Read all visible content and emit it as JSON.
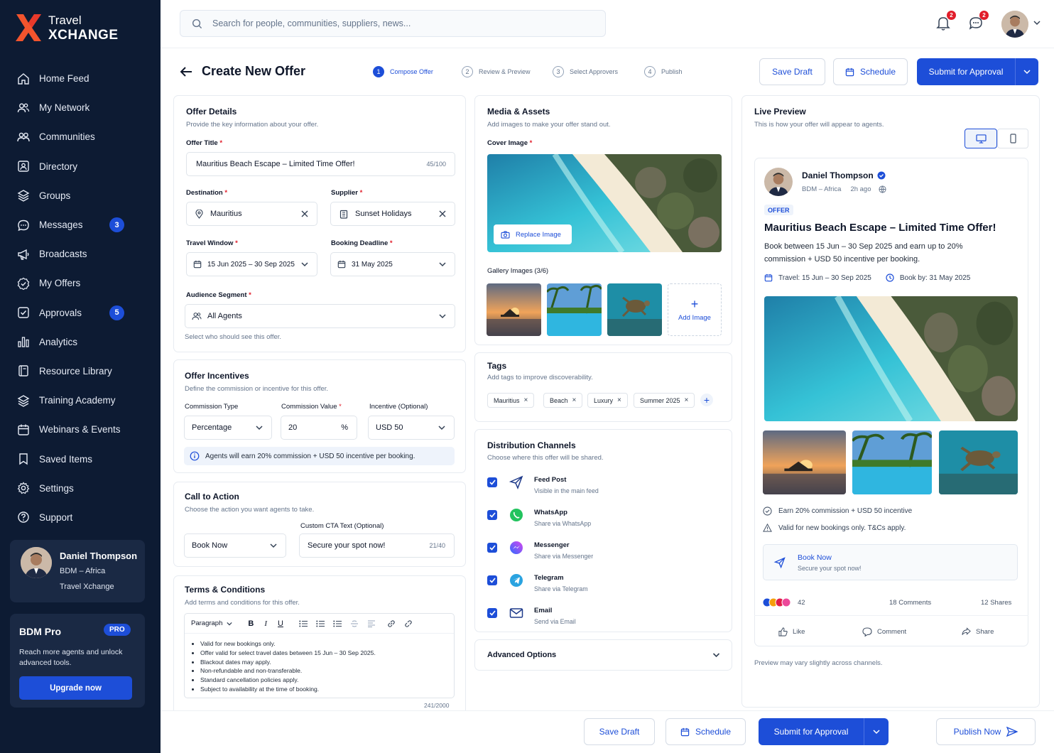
{
  "app": {
    "logo_line1": "Travel",
    "logo_line2": "XCHANGE"
  },
  "sidebar": {
    "items": [
      {
        "label": "Home Feed",
        "icon": "home-icon"
      },
      {
        "label": "My Network",
        "icon": "users-icon"
      },
      {
        "label": "Communities",
        "icon": "communities-icon"
      },
      {
        "label": "Directory",
        "icon": "directory-icon"
      },
      {
        "label": "Groups",
        "icon": "layers-icon"
      },
      {
        "label": "Messages",
        "icon": "chat-icon",
        "badge": "3"
      },
      {
        "label": "Broadcasts",
        "icon": "megaphone-icon"
      },
      {
        "label": "My Offers",
        "icon": "badge-check-icon"
      },
      {
        "label": "Approvals",
        "icon": "checkbox-icon",
        "badge": "5"
      },
      {
        "label": "Analytics",
        "icon": "bar-chart-icon"
      },
      {
        "label": "Resource Library",
        "icon": "book-icon"
      },
      {
        "label": "Training Academy",
        "icon": "layers-icon"
      },
      {
        "label": "Webinars & Events",
        "icon": "calendar-icon"
      },
      {
        "label": "Saved Items",
        "icon": "bookmark-icon"
      },
      {
        "label": "Settings",
        "icon": "gear-icon"
      },
      {
        "label": "Support",
        "icon": "help-icon"
      }
    ],
    "profile": {
      "name": "Daniel Thompson",
      "role": "BDM – Africa",
      "company": "Travel Xchange"
    },
    "pro": {
      "title": "BDM Pro",
      "badge": "PRO",
      "desc": "Reach more agents and unlock advanced tools.",
      "cta": "Upgrade now"
    }
  },
  "topbar": {
    "search_placeholder": "Search for people, communities, suppliers, news...",
    "notif_count": "2",
    "msg_count": "2"
  },
  "header": {
    "title": "Create New Offer",
    "steps": [
      {
        "n": "1",
        "label": "Compose Offer",
        "active": true
      },
      {
        "n": "2",
        "label": "Review & Preview"
      },
      {
        "n": "3",
        "label": "Select Approvers"
      },
      {
        "n": "4",
        "label": "Publish"
      }
    ],
    "save_draft": "Save Draft",
    "schedule": "Schedule",
    "submit": "Submit for Approval"
  },
  "offer_details": {
    "title": "Offer Details",
    "subtitle": "Provide the key information about your offer.",
    "offer_title_label": "Offer Title",
    "offer_title_value": "Mauritius Beach Escape – Limited Time Offer!",
    "offer_title_count": "45/100",
    "destination_label": "Destination",
    "destination_value": "Mauritius",
    "supplier_label": "Supplier",
    "supplier_value": "Sunset Holidays",
    "travel_window_label": "Travel Window",
    "travel_window_value": "15 Jun 2025 – 30 Sep 2025",
    "booking_deadline_label": "Booking Deadline",
    "booking_deadline_value": "31 May 2025",
    "audience_label": "Audience Segment",
    "audience_value": "All Agents",
    "audience_help": "Select who should see this offer."
  },
  "incentives": {
    "title": "Offer Incentives",
    "subtitle": "Define the commission or incentive for this offer.",
    "type_label": "Commission Type",
    "type_value": "Percentage",
    "value_label": "Commission Value",
    "value_value": "20",
    "value_unit": "%",
    "incentive_label": "Incentive (Optional)",
    "incentive_value": "USD 50",
    "info": "Agents will earn 20% commission + USD 50 incentive per booking."
  },
  "cta": {
    "title": "Call to Action",
    "subtitle": "Choose the action you want agents to take.",
    "action_value": "Book Now",
    "custom_label": "Custom CTA Text (Optional)",
    "custom_value": "Secure your spot now!",
    "custom_count": "21/40"
  },
  "terms": {
    "title": "Terms & Conditions",
    "subtitle": "Add terms and conditions for this offer.",
    "format": "Paragraph",
    "items": [
      "Valid for new bookings only.",
      "Offer valid for select travel dates between 15 Jun – 30 Sep 2025.",
      "Blackout dates may apply.",
      "Non-refundable and non-transferable.",
      "Standard cancellation policies apply.",
      "Subject to availability at the time of booking."
    ],
    "count": "241/2000"
  },
  "media": {
    "title": "Media & Assets",
    "subtitle": "Add images to make your offer stand out.",
    "cover_label": "Cover Image",
    "replace": "Replace Image",
    "gallery_label": "Gallery Images (3/6)",
    "add_image": "Add Image"
  },
  "tags": {
    "title": "Tags",
    "subtitle": "Add tags to improve discoverability.",
    "items": [
      "Mauritius",
      "Beach",
      "Luxury",
      "Summer 2025"
    ]
  },
  "distribution": {
    "title": "Distribution Channels",
    "subtitle": "Choose where this offer will be shared.",
    "channels": [
      {
        "name": "Feed Post",
        "desc": "Visible in the main feed",
        "icon": "send-icon"
      },
      {
        "name": "WhatsApp",
        "desc": "Share via WhatsApp",
        "icon": "whatsapp-icon"
      },
      {
        "name": "Messenger",
        "desc": "Share via Messenger",
        "icon": "messenger-icon"
      },
      {
        "name": "Telegram",
        "desc": "Share via Telegram",
        "icon": "telegram-icon"
      },
      {
        "name": "Email",
        "desc": "Send via Email",
        "icon": "mail-icon"
      }
    ],
    "advanced": "Advanced Options"
  },
  "preview": {
    "title": "Live Preview",
    "subtitle": "This is how your offer will appear to agents.",
    "author": "Daniel Thompson",
    "role": "BDM – Africa",
    "time": "2h ago",
    "badge": "OFFER",
    "headline": "Mauritius Beach Escape – Limited Time Offer!",
    "body": "Book between 15 Jun – 30 Sep 2025 and earn up to 20% commission + USD 50 incentive per booking.",
    "travel": "Travel: 15 Jun – 30 Sep 2025",
    "book_by": "Book by: 31 May 2025",
    "earn": "Earn 20% commission + USD 50 incentive",
    "valid": "Valid for new bookings only. T&Cs apply.",
    "cta_title": "Book Now",
    "cta_sub": "Secure your spot now!",
    "reactions": "42",
    "comments": "18 Comments",
    "shares": "12 Shares",
    "like": "Like",
    "comment": "Comment",
    "share": "Share",
    "note": "Preview may vary slightly across channels."
  },
  "footer": {
    "save_draft": "Save Draft",
    "schedule": "Schedule",
    "submit": "Submit for Approval",
    "publish": "Publish Now"
  },
  "colors": {
    "primary": "#1d4ed8",
    "sidebar": "#0d1b33",
    "danger": "#e11d2a"
  }
}
